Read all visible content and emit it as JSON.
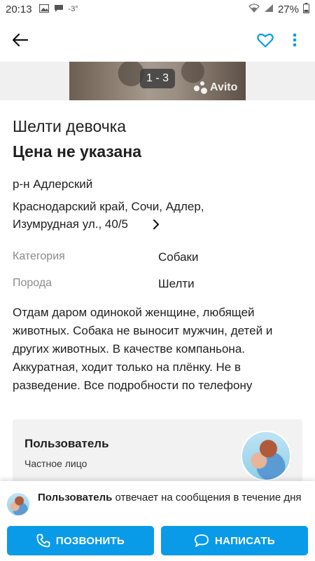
{
  "status": {
    "time": "20:13",
    "battery": "27%",
    "temp": "-3°"
  },
  "gallery": {
    "counter": "1 - 3",
    "watermark": "Avito"
  },
  "listing": {
    "title": "Шелти девочка",
    "price": "Цена не указана",
    "district": "р-н Адлерский",
    "address_line1": "Краснодарский край, Сочи, Адлер,",
    "address_line2": "Изумрудная ул., 40/5"
  },
  "properties": [
    {
      "key": "Категория",
      "value": "Собаки"
    },
    {
      "key": "Порода",
      "value": "Шелти"
    }
  ],
  "description": "Отдам даром одинокой женщине, любящей животных. Собака не выносит мужчин, детей и других животных. В качестве компаньона. Аккуратная, ходит только на плёнку. Не в разведение. Все подробности по телефону",
  "seller": {
    "name": "Пользователь",
    "type": "Частное лицо"
  },
  "reply": {
    "name": "Пользователь",
    "text": "отвечает на сообщения в течение дня"
  },
  "actions": {
    "call": "ПОЗВОНИТЬ",
    "write": "НАПИСАТЬ"
  },
  "colors": {
    "accent": "#0a9be8",
    "heart": "#0a9be8"
  }
}
